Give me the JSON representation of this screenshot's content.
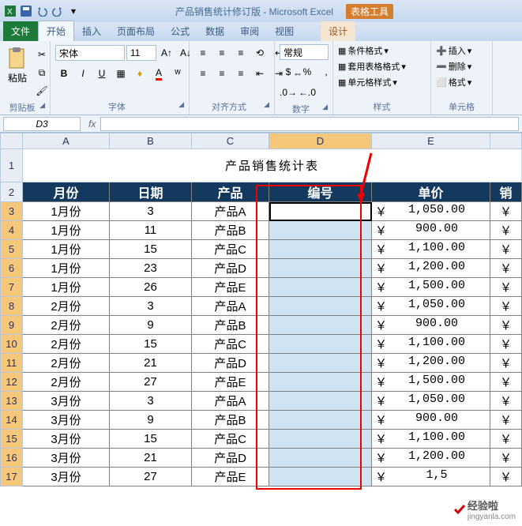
{
  "titlebar": {
    "doc_title": "产品销售统计修订版 - Microsoft Excel",
    "table_tools": "表格工具"
  },
  "tabs": {
    "file": "文件",
    "home": "开始",
    "insert": "插入",
    "layout": "页面布局",
    "formulas": "公式",
    "data": "数据",
    "review": "审阅",
    "view": "视图",
    "design": "设计"
  },
  "ribbon": {
    "clipboard": {
      "label": "剪贴板",
      "paste": "粘贴"
    },
    "font": {
      "label": "字体",
      "name": "宋体",
      "size": "11"
    },
    "align": {
      "label": "对齐方式"
    },
    "number": {
      "label": "数字",
      "format": "常规"
    },
    "styles": {
      "label": "样式",
      "cond": "条件格式",
      "table": "套用表格格式",
      "cell": "单元格样式"
    },
    "cells": {
      "label": "单元格",
      "insert": "插入",
      "delete": "删除",
      "format": "格式"
    }
  },
  "namebox": "D3",
  "cols": [
    "A",
    "B",
    "C",
    "D",
    "E"
  ],
  "sheet": {
    "title": "产品销售统计表",
    "headers": {
      "a": "月份",
      "b": "日期",
      "c": "产品",
      "d": "编号",
      "e": "单价",
      "f": "销"
    },
    "rows": [
      {
        "n": "3",
        "a": "1月份",
        "b": "3",
        "c": "产品A",
        "e": "1,050.00"
      },
      {
        "n": "4",
        "a": "1月份",
        "b": "11",
        "c": "产品B",
        "e": "900.00"
      },
      {
        "n": "5",
        "a": "1月份",
        "b": "15",
        "c": "产品C",
        "e": "1,100.00"
      },
      {
        "n": "6",
        "a": "1月份",
        "b": "23",
        "c": "产品D",
        "e": "1,200.00"
      },
      {
        "n": "7",
        "a": "1月份",
        "b": "26",
        "c": "产品E",
        "e": "1,500.00"
      },
      {
        "n": "8",
        "a": "2月份",
        "b": "3",
        "c": "产品A",
        "e": "1,050.00"
      },
      {
        "n": "9",
        "a": "2月份",
        "b": "9",
        "c": "产品B",
        "e": "900.00"
      },
      {
        "n": "10",
        "a": "2月份",
        "b": "15",
        "c": "产品C",
        "e": "1,100.00"
      },
      {
        "n": "11",
        "a": "2月份",
        "b": "21",
        "c": "产品D",
        "e": "1,200.00"
      },
      {
        "n": "12",
        "a": "2月份",
        "b": "27",
        "c": "产品E",
        "e": "1,500.00"
      },
      {
        "n": "13",
        "a": "3月份",
        "b": "3",
        "c": "产品A",
        "e": "1,050.00"
      },
      {
        "n": "14",
        "a": "3月份",
        "b": "9",
        "c": "产品B",
        "e": "900.00"
      },
      {
        "n": "15",
        "a": "3月份",
        "b": "15",
        "c": "产品C",
        "e": "1,100.00"
      },
      {
        "n": "16",
        "a": "3月份",
        "b": "21",
        "c": "产品D",
        "e": "1,200.00"
      },
      {
        "n": "17",
        "a": "3月份",
        "b": "27",
        "c": "产品E",
        "e": "1,5"
      }
    ],
    "currency": "￥"
  },
  "watermark": {
    "a": "经验啦",
    "b": "jingyanla.com"
  }
}
